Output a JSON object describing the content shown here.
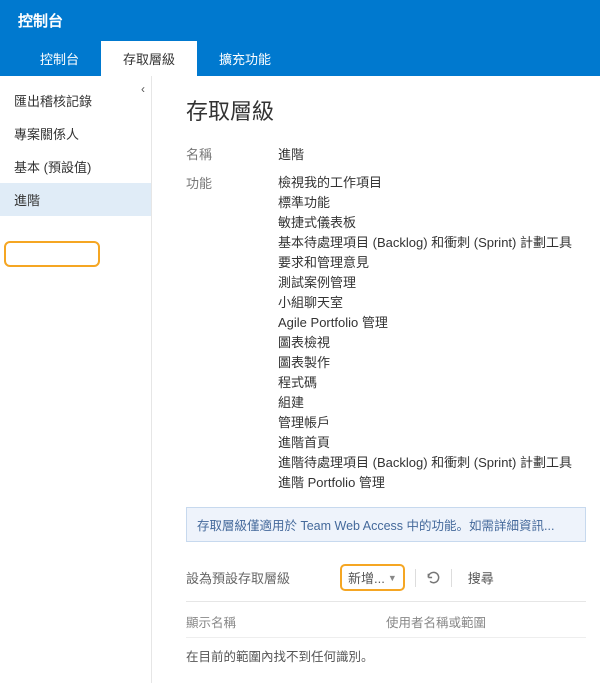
{
  "header": {
    "title": "控制台"
  },
  "tabs": [
    {
      "label": "控制台"
    },
    {
      "label": "存取層級"
    },
    {
      "label": "擴充功能"
    }
  ],
  "sidebar": {
    "items": [
      {
        "label": "匯出稽核記錄"
      },
      {
        "label": "專案關係人"
      },
      {
        "label": "基本 (預設值)"
      },
      {
        "label": "進階"
      }
    ]
  },
  "content": {
    "heading": "存取層級",
    "name_label": "名稱",
    "name_value": "進階",
    "features_label": "功能",
    "features": [
      "檢視我的工作項目",
      "標準功能",
      "敏捷式儀表板",
      "基本待處理項目 (Backlog) 和衝刺 (Sprint) 計劃工具",
      "要求和管理意見",
      "測試案例管理",
      "小組聊天室",
      "Agile Portfolio 管理",
      "圖表檢視",
      "圖表製作",
      "程式碼",
      "組建",
      "管理帳戶",
      "進階首頁",
      "進階待處理項目 (Backlog) 和衝刺 (Sprint) 計劃工具",
      "進階 Portfolio 管理"
    ],
    "info_banner": "存取層級僅適用於 Team Web Access 中的功能。如需詳細資訊...",
    "actions": {
      "set_default_label": "設為預設存取層級",
      "add_label": "新增...",
      "search_label": "搜尋"
    },
    "table": {
      "col_name": "顯示名稱",
      "col_user": "使用者名稱或範圍",
      "empty": "在目前的範圍內找不到任何識別。"
    }
  }
}
